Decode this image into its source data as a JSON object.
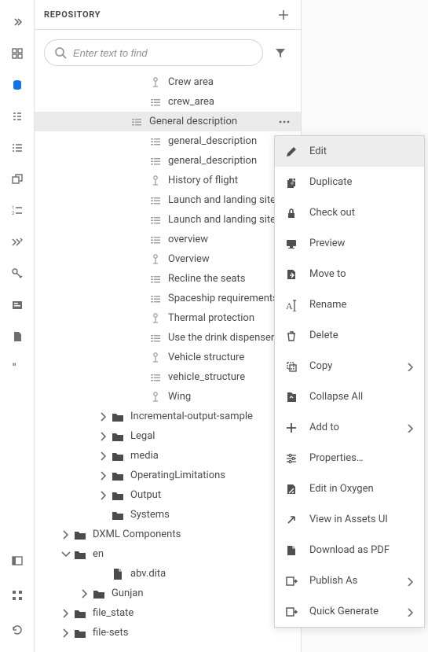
{
  "panel": {
    "title": "REPOSITORY",
    "search_placeholder": "Enter text to find"
  },
  "tree": [
    {
      "label": "Crew area",
      "depth": 5,
      "icon": "tag",
      "selected": false
    },
    {
      "label": "crew_area",
      "depth": 5,
      "icon": "topic",
      "selected": false
    },
    {
      "label": "General description",
      "depth": 4,
      "icon": "topic",
      "selected": true,
      "showMore": true
    },
    {
      "label": "general_description",
      "depth": 5,
      "icon": "topic",
      "selected": false
    },
    {
      "label": "general_description",
      "depth": 5,
      "icon": "topic",
      "selected": false
    },
    {
      "label": "History of flight",
      "depth": 5,
      "icon": "tag",
      "selected": false
    },
    {
      "label": "Launch and landing site",
      "depth": 5,
      "icon": "topic",
      "selected": false
    },
    {
      "label": "Launch and landing site",
      "depth": 5,
      "icon": "topic",
      "selected": false
    },
    {
      "label": "overview",
      "depth": 5,
      "icon": "topic",
      "selected": false
    },
    {
      "label": "Overview",
      "depth": 5,
      "icon": "tag",
      "selected": false
    },
    {
      "label": "Recline the seats",
      "depth": 5,
      "icon": "topic",
      "selected": false
    },
    {
      "label": "Spaceship requirements",
      "depth": 5,
      "icon": "topic",
      "selected": false
    },
    {
      "label": "Thermal protection",
      "depth": 5,
      "icon": "tag",
      "selected": false
    },
    {
      "label": "Use the drink dispenser",
      "depth": 5,
      "icon": "topic",
      "selected": false
    },
    {
      "label": "Vehicle structure",
      "depth": 5,
      "icon": "tag",
      "selected": false
    },
    {
      "label": "vehicle_structure",
      "depth": 5,
      "icon": "topic",
      "selected": false
    },
    {
      "label": "Wing",
      "depth": 5,
      "icon": "tag",
      "selected": false
    },
    {
      "label": "Incremental-output-sample",
      "depth": 3,
      "icon": "folder",
      "chevron": "right"
    },
    {
      "label": "Legal",
      "depth": 3,
      "icon": "folder",
      "chevron": "right"
    },
    {
      "label": "media",
      "depth": 3,
      "icon": "folder",
      "chevron": "right"
    },
    {
      "label": "OperatingLimitations",
      "depth": 3,
      "icon": "folder",
      "chevron": "right"
    },
    {
      "label": "Output",
      "depth": 3,
      "icon": "folder",
      "chevron": "right"
    },
    {
      "label": "Systems",
      "depth": 3,
      "icon": "folder",
      "chevron": "blank"
    },
    {
      "label": "DXML Components",
      "depth": 1,
      "icon": "folder",
      "chevron": "right"
    },
    {
      "label": "en",
      "depth": 1,
      "icon": "folder",
      "chevron": "down"
    },
    {
      "label": "abv.dita",
      "depth": 3,
      "icon": "file",
      "chevron": "blank"
    },
    {
      "label": "Gunjan",
      "depth": 2,
      "icon": "folder",
      "chevron": "right"
    },
    {
      "label": "file_state",
      "depth": 1,
      "icon": "folder",
      "chevron": "right"
    },
    {
      "label": "file-sets",
      "depth": 1,
      "icon": "folder",
      "chevron": "right"
    }
  ],
  "context_menu": [
    {
      "label": "Edit",
      "icon": "edit",
      "highlight": true
    },
    {
      "label": "Duplicate",
      "icon": "duplicate"
    },
    {
      "label": "Check out",
      "icon": "lock"
    },
    {
      "label": "Preview",
      "icon": "preview"
    },
    {
      "label": "Move to",
      "icon": "move"
    },
    {
      "label": "Rename",
      "icon": "rename"
    },
    {
      "label": "Delete",
      "icon": "delete"
    },
    {
      "label": "Copy",
      "icon": "copy",
      "arrow": true
    },
    {
      "label": "Collapse All",
      "icon": "collapse"
    },
    {
      "label": "Add to",
      "icon": "plus",
      "arrow": true
    },
    {
      "label": "Properties…",
      "icon": "properties"
    },
    {
      "label": "Edit in Oxygen",
      "icon": "oxygen"
    },
    {
      "label": "View in Assets UI",
      "icon": "external"
    },
    {
      "label": "Download as PDF",
      "icon": "pdf"
    },
    {
      "label": "Publish As",
      "icon": "publish",
      "arrow": true
    },
    {
      "label": "Quick Generate",
      "icon": "quick",
      "arrow": true
    }
  ]
}
